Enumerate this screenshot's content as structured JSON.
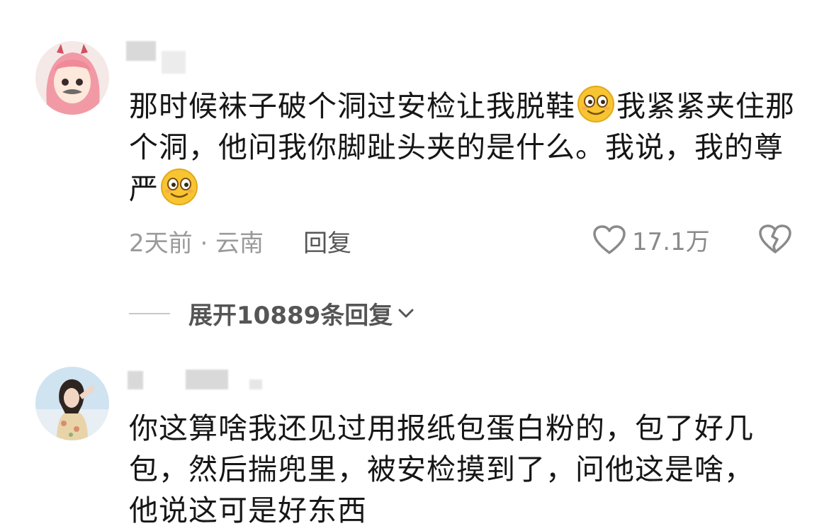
{
  "comments": [
    {
      "text_parts": [
        "那时候袜子破个洞过安检让我脱鞋",
        "我紧紧夹住那个洞，他问我你脚趾头夹的是什么。我说，我的尊严"
      ],
      "time_location": "2天前 · 云南",
      "reply_label": "回复",
      "like_count": "17.1万",
      "expand_label": "展开10889条回复"
    },
    {
      "text": "你这算啥我还见过用报纸包蛋白粉的，包了好几包，然后揣兜里，被安检摸到了，问他这是啥，他说这可是好东西"
    }
  ],
  "icons": {
    "emoji": "smiling-face-emoji",
    "like": "heart-icon",
    "dislike": "broken-heart-icon",
    "expand": "chevron-down-icon"
  },
  "colors": {
    "text": "#161616",
    "meta": "#9a9a9a",
    "reply": "#555555",
    "emoji_face": "#f7c531"
  }
}
